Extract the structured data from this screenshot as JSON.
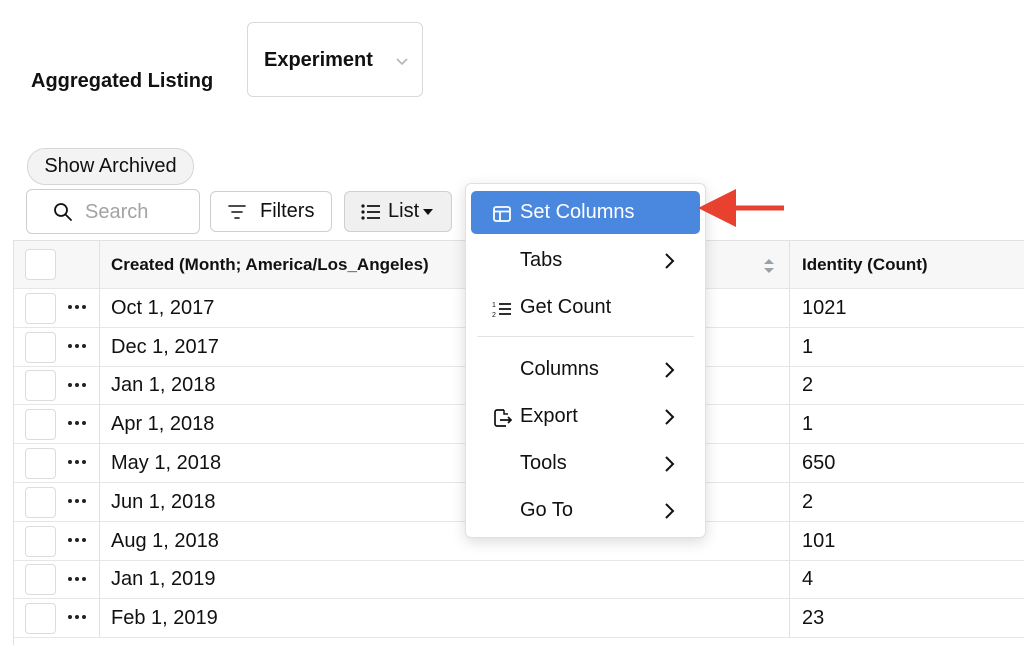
{
  "header": {
    "title": "Aggregated Listing",
    "entity_select": "Experiment"
  },
  "toolbar": {
    "show_archived": "Show Archived",
    "search_placeholder": "Search",
    "filters": "Filters",
    "list": "List"
  },
  "table": {
    "columns": [
      "Created (Month; America/Los_Angeles)",
      "Identity (Count)"
    ],
    "rows": [
      {
        "date": "Oct 1, 2017",
        "count": "1021"
      },
      {
        "date": "Dec 1, 2017",
        "count": "1"
      },
      {
        "date": "Jan 1, 2018",
        "count": "2"
      },
      {
        "date": "Apr 1, 2018",
        "count": "1"
      },
      {
        "date": "May 1, 2018",
        "count": "650"
      },
      {
        "date": "Jun 1, 2018",
        "count": "2"
      },
      {
        "date": "Aug 1, 2018",
        "count": "101"
      },
      {
        "date": "Jan 1, 2019",
        "count": "4"
      },
      {
        "date": "Feb 1, 2019",
        "count": "23"
      }
    ]
  },
  "menu": {
    "items": [
      {
        "label": "Set Columns",
        "icon": "columns-icon",
        "submenu": false,
        "active": true
      },
      {
        "label": "Tabs",
        "icon": "",
        "submenu": true,
        "active": false
      },
      {
        "label": "Get Count",
        "icon": "numbered-list-icon",
        "submenu": false,
        "active": false
      },
      {
        "label": "Columns",
        "icon": "",
        "submenu": true,
        "active": false
      },
      {
        "label": "Export",
        "icon": "export-icon",
        "submenu": true,
        "active": false
      },
      {
        "label": "Tools",
        "icon": "",
        "submenu": true,
        "active": false
      },
      {
        "label": "Go To",
        "icon": "",
        "submenu": true,
        "active": false
      }
    ]
  },
  "colors": {
    "accent": "#4a88e0",
    "annotation_arrow": "#e8412f"
  }
}
